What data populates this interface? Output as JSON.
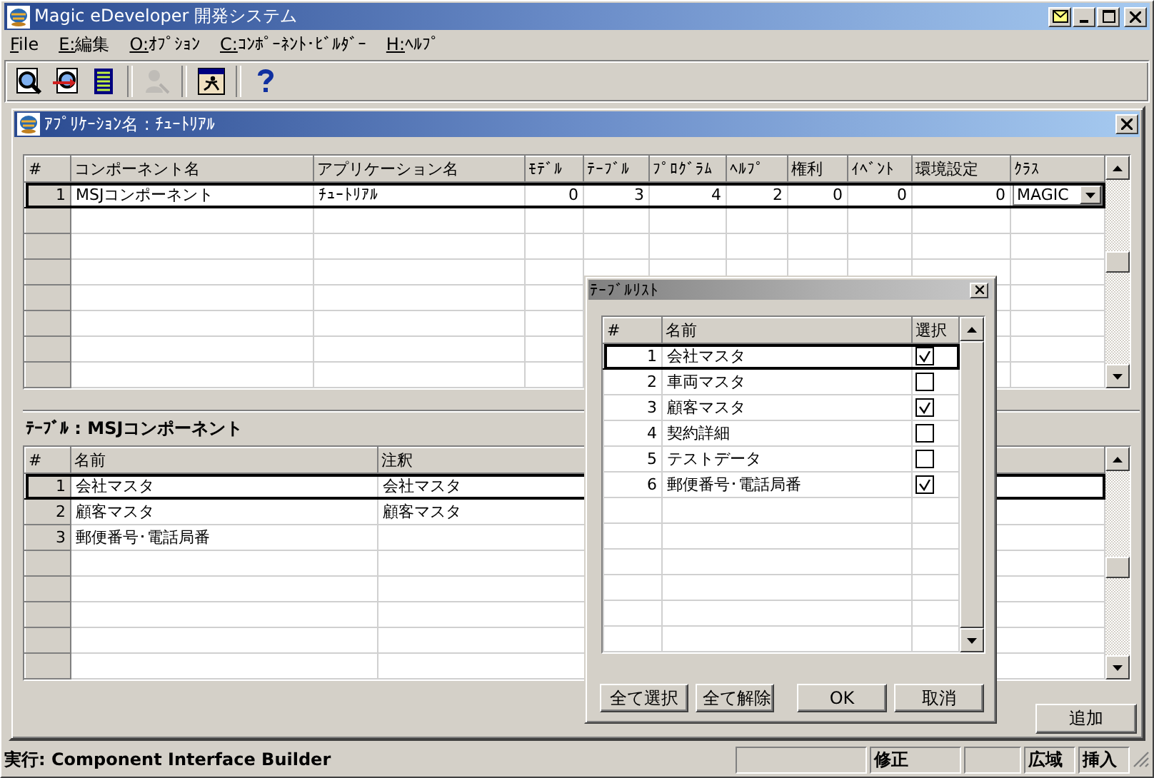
{
  "window": {
    "title": "Magic eDeveloper 開発システム"
  },
  "menu": [
    {
      "label": "File"
    },
    {
      "label": "E:編集"
    },
    {
      "label": "O:ｵﾌﾟｼｮﾝ"
    },
    {
      "label": "C:ｺﾝﾎﾟｰﾈﾝﾄ･ﾋﾞﾙﾀﾞｰ"
    },
    {
      "label": "H:ﾍﾙﾌﾟ"
    }
  ],
  "toolbar": [
    {
      "kind": "open",
      "disabled": false
    },
    {
      "kind": "import",
      "disabled": false
    },
    {
      "kind": "list",
      "disabled": false
    },
    {
      "kind": "sep"
    },
    {
      "kind": "user",
      "disabled": true
    },
    {
      "kind": "sep"
    },
    {
      "kind": "run",
      "disabled": false
    },
    {
      "kind": "sep"
    },
    {
      "kind": "help",
      "disabled": false
    }
  ],
  "child_window": {
    "title": "ｱﾌﾟﾘｹｰｼｮﾝ名 : ﾁｭｰﾄﾘｱﾙ"
  },
  "component_table": {
    "columns": [
      "#",
      "コンポーネント名",
      "アプリケーション名",
      "ﾓﾃﾞﾙ",
      "ﾃｰﾌﾞﾙ",
      "ﾌﾟﾛｸﾞﾗﾑ",
      "ﾍﾙﾌﾟ",
      "権利",
      "ｲﾍﾞﾝﾄ",
      "環境設定",
      "ｸﾗｽ"
    ],
    "rows": [
      {
        "selected": true,
        "cells": [
          "1",
          "MSJコンポーネント",
          "ﾁｭｰﾄﾘｱﾙ",
          "0",
          "3",
          "4",
          "2",
          "0",
          "0",
          "0",
          "MAGIC"
        ]
      }
    ]
  },
  "table_section": {
    "label": "ﾃｰﾌﾞﾙ : MSJコンポーネント",
    "columns": [
      "#",
      "名前",
      "注釈"
    ],
    "rows": [
      {
        "selected": true,
        "cells": [
          "1",
          "会社マスタ",
          "会社マスタ"
        ]
      },
      {
        "selected": false,
        "cells": [
          "2",
          "顧客マスタ",
          "顧客マスタ"
        ]
      },
      {
        "selected": false,
        "cells": [
          "3",
          "郵便番号･電話局番"
        ]
      }
    ]
  },
  "add_button": "追加",
  "table_list_dialog": {
    "title": "ﾃｰﾌﾞﾙﾘｽﾄ",
    "columns": [
      "#",
      "名前",
      "選択"
    ],
    "rows": [
      {
        "number": "1",
        "name": "会社マスタ",
        "checked": true,
        "selected": true
      },
      {
        "number": "2",
        "name": "車両マスタ",
        "checked": false,
        "selected": false
      },
      {
        "number": "3",
        "name": "顧客マスタ",
        "checked": true,
        "selected": false
      },
      {
        "number": "4",
        "name": "契約詳細",
        "checked": false,
        "selected": false
      },
      {
        "number": "5",
        "name": "テストデータ",
        "checked": false,
        "selected": false
      },
      {
        "number": "6",
        "name": "郵便番号･電話局番",
        "checked": true,
        "selected": false
      }
    ],
    "buttons": [
      "全て選択",
      "全て解除",
      "OK",
      "取消"
    ]
  },
  "status_bar": {
    "message": "実行: Component Interface Builder",
    "panels": [
      {
        "kind": "blank"
      },
      {
        "kind": "text",
        "text": "修正"
      },
      {
        "kind": "blank"
      },
      {
        "kind": "text",
        "text": "広域"
      },
      {
        "kind": "text",
        "text": "挿入"
      }
    ]
  }
}
